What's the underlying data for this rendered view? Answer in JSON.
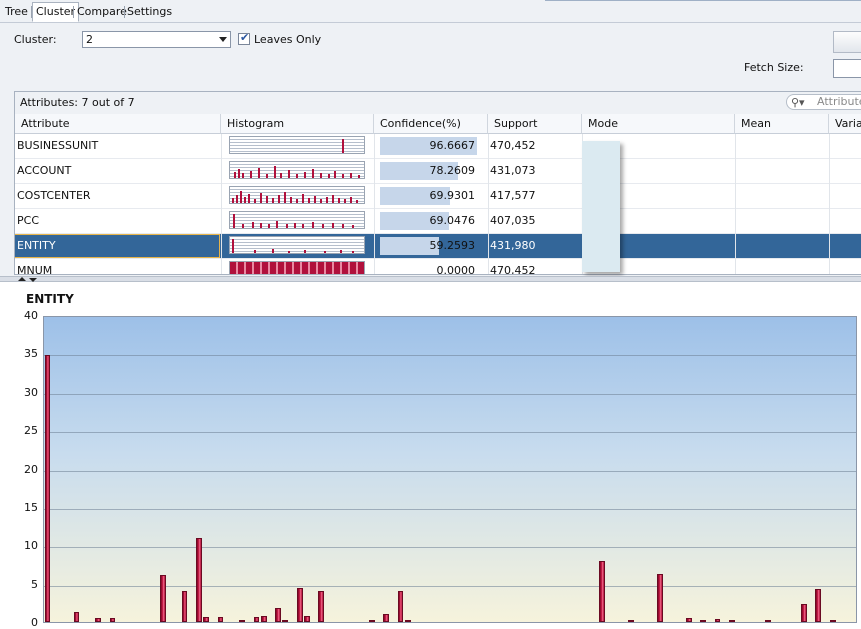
{
  "tabs": [
    {
      "label": "Tree",
      "active": false
    },
    {
      "label": "Cluster",
      "active": true
    },
    {
      "label": "Compare",
      "active": false
    },
    {
      "label": "Settings",
      "active": false
    }
  ],
  "toolbar": {
    "cluster_label": "Cluster:",
    "cluster_value": "2",
    "leaves_only_label": "Leaves Only",
    "leaves_only_checked": true,
    "fetch_size_label": "Fetch Size:"
  },
  "grid": {
    "summary": "Attributes: 7 out of 7",
    "search_placeholder": "Attribute",
    "columns": [
      "Attribute",
      "Histogram",
      "Confidence(%)",
      "Support",
      "Mode",
      "Mean",
      "Varian"
    ],
    "rows": [
      {
        "attribute": "BUSINESSUNIT",
        "confidence": "96.6667",
        "confidence_pct": 96.6667,
        "support": "470,452",
        "selected": false
      },
      {
        "attribute": "ACCOUNT",
        "confidence": "78.2609",
        "confidence_pct": 78.2609,
        "support": "431,073",
        "selected": false
      },
      {
        "attribute": "COSTCENTER",
        "confidence": "69.9301",
        "confidence_pct": 69.9301,
        "support": "417,577",
        "selected": false
      },
      {
        "attribute": "PCC",
        "confidence": "69.0476",
        "confidence_pct": 69.0476,
        "support": "407,035",
        "selected": false
      },
      {
        "attribute": "ENTITY",
        "confidence": "59.2593",
        "confidence_pct": 59.2593,
        "support": "431,980",
        "selected": true
      },
      {
        "attribute": "MNUM",
        "confidence": "0.0000",
        "confidence_pct": 0,
        "support": "470,452",
        "selected": false
      }
    ]
  },
  "colors": {
    "selection": "#336699",
    "bar": "#b5103a",
    "confidence_bar": "#c6d6ea"
  },
  "chart_data": {
    "type": "bar",
    "title": "ENTITY",
    "ylim": [
      0,
      40
    ],
    "yticks": [
      0,
      5,
      10,
      15,
      20,
      25,
      30,
      35,
      40
    ],
    "grid": true,
    "values": [
      34.8,
      0,
      0,
      0,
      1.3,
      0,
      0,
      0.5,
      0,
      0.5,
      0,
      0,
      0,
      0,
      0,
      0,
      6.1,
      0,
      0,
      4.1,
      0,
      11,
      0.6,
      0,
      0.6,
      0,
      0,
      0.2,
      0,
      0.6,
      0.8,
      0,
      1.8,
      0.3,
      0,
      4.4,
      0.8,
      0,
      4.1,
      0,
      0,
      0,
      0,
      0,
      0,
      0.3,
      0,
      1.0,
      0,
      4.1,
      0.3,
      0,
      0,
      0,
      0,
      0,
      0,
      0,
      0,
      0,
      0,
      0,
      0,
      0,
      0,
      0,
      0,
      0,
      0,
      0,
      0,
      0,
      0,
      0,
      0,
      0,
      0,
      7.9,
      0,
      0,
      0,
      0.3,
      0,
      0,
      0,
      6.3,
      0,
      0,
      0,
      0.5,
      0,
      0.3,
      0,
      0.4,
      0,
      0.3,
      0,
      0,
      0,
      0,
      0.2,
      0,
      0,
      0,
      0,
      2.3,
      0,
      4.3,
      0,
      0.3,
      0,
      0,
      0
    ]
  }
}
